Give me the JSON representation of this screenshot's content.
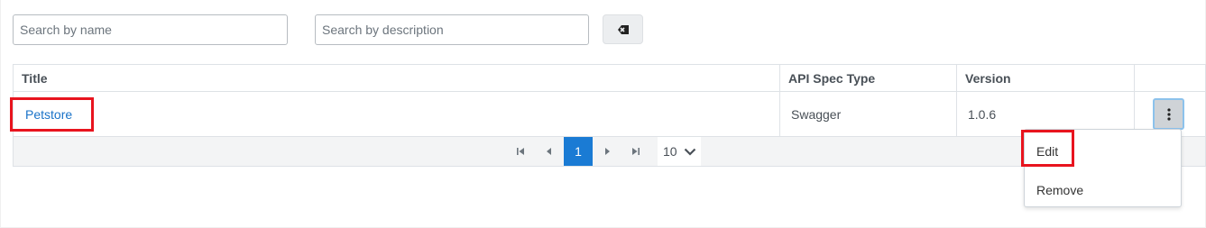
{
  "filters": {
    "name_placeholder": "Search by name",
    "description_placeholder": "Search by description",
    "clear_icon": "eraser-icon"
  },
  "table": {
    "columns": [
      "Title",
      "API Spec Type",
      "Version"
    ],
    "rows": [
      {
        "title": "Petstore",
        "spec_type": "Swagger",
        "version": "1.0.6",
        "actions_icon": "kebab-menu-icon"
      }
    ]
  },
  "pagination": {
    "current_page": "1",
    "rows_per_page": "10",
    "icons": [
      "first-page-icon",
      "prev-page-icon",
      "next-page-icon",
      "last-page-icon",
      "chevron-down-icon"
    ]
  },
  "actions_menu": {
    "items": [
      "Edit",
      "Remove"
    ]
  },
  "colors": {
    "highlight": "#e8141e",
    "link": "#1a73c8",
    "active_page": "#1a7bd4"
  }
}
